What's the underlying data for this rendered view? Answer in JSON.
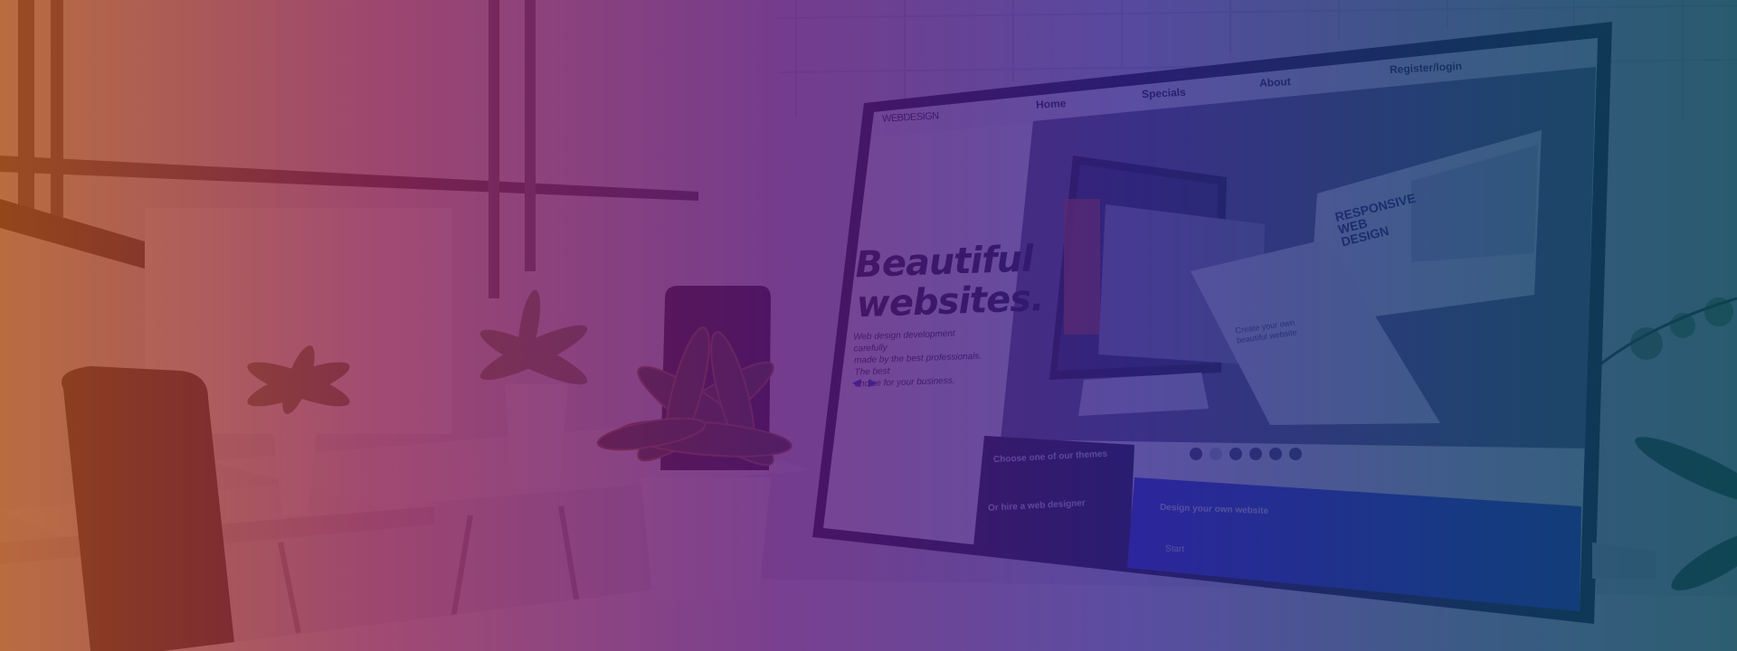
{
  "site": {
    "logo_bold": "WEB",
    "logo_light": "DESIGN",
    "nav": [
      "Home",
      "Specials",
      "About",
      "Register/login"
    ],
    "hero_title_line1": "Beautiful",
    "hero_title_line2": "websites.",
    "hero_sub_line1": "Web design development carefully",
    "hero_sub_line2": "made by the best professionals. The best",
    "hero_sub_line3": "choice for your business.",
    "slide_heading_1": "RESPONSIVE",
    "slide_heading_2": "WEB",
    "slide_heading_3": "DESIGN",
    "tablet_line1": "Create your own",
    "tablet_line2": "beautiful website",
    "card1_title": "Choose one of our themes",
    "card2_title": "Or hire a web designer",
    "card3_title": "Design your own website",
    "card3_button": "Start"
  },
  "colors": {
    "overlay_left": "#b25318",
    "overlay_mid": "#5c1678",
    "overlay_right": "#0a465a",
    "site_accent": "#1c2fd6"
  }
}
